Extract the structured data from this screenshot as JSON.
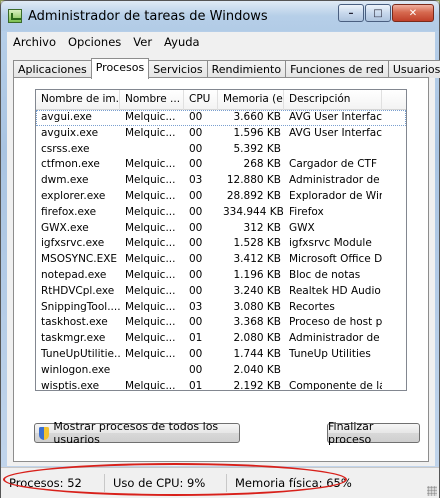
{
  "window": {
    "title": "Administrador de tareas de Windows"
  },
  "menu": [
    "Archivo",
    "Opciones",
    "Ver",
    "Ayuda"
  ],
  "tabs": [
    {
      "label": "Aplicaciones",
      "active": false
    },
    {
      "label": "Procesos",
      "active": true
    },
    {
      "label": "Servicios",
      "active": false
    },
    {
      "label": "Rendimiento",
      "active": false
    },
    {
      "label": "Funciones de red",
      "active": false
    },
    {
      "label": "Usuarios",
      "active": false
    }
  ],
  "columns": [
    "Nombre de im...",
    "Nombre ...",
    "CPU",
    "Memoria (e...",
    "Descripción"
  ],
  "processes": [
    {
      "name": "avgui.exe",
      "user": "Melquic...",
      "cpu": "00",
      "mem": "3.660 KB",
      "desc": "AVG User Interface"
    },
    {
      "name": "avguix.exe",
      "user": "Melquic...",
      "cpu": "00",
      "mem": "1.596 KB",
      "desc": "AVG User Interface"
    },
    {
      "name": "csrss.exe",
      "user": "",
      "cpu": "00",
      "mem": "5.392 KB",
      "desc": ""
    },
    {
      "name": "ctfmon.exe",
      "user": "Melquic...",
      "cpu": "00",
      "mem": "268 KB",
      "desc": "Cargador de CTF"
    },
    {
      "name": "dwm.exe",
      "user": "Melquic...",
      "cpu": "03",
      "mem": "12.880 KB",
      "desc": "Administrador de ..."
    },
    {
      "name": "explorer.exe",
      "user": "Melquic...",
      "cpu": "00",
      "mem": "28.892 KB",
      "desc": "Explorador de Win..."
    },
    {
      "name": "firefox.exe",
      "user": "Melquic...",
      "cpu": "00",
      "mem": "334.944 KB",
      "desc": "Firefox"
    },
    {
      "name": "GWX.exe",
      "user": "Melquic...",
      "cpu": "00",
      "mem": "312 KB",
      "desc": "GWX"
    },
    {
      "name": "igfxsrvc.exe",
      "user": "Melquic...",
      "cpu": "00",
      "mem": "1.528 KB",
      "desc": "igfxsrvc Module"
    },
    {
      "name": "MSOSYNC.EXE",
      "user": "Melquic...",
      "cpu": "00",
      "mem": "3.412 KB",
      "desc": "Microsoft Office D..."
    },
    {
      "name": "notepad.exe",
      "user": "Melquic...",
      "cpu": "00",
      "mem": "1.196 KB",
      "desc": "Bloc de notas"
    },
    {
      "name": "RtHDVCpl.exe",
      "user": "Melquic...",
      "cpu": "00",
      "mem": "3.240 KB",
      "desc": "Realtek HD Audio ..."
    },
    {
      "name": "SnippingTool....",
      "user": "Melquic...",
      "cpu": "03",
      "mem": "3.080 KB",
      "desc": "Recortes"
    },
    {
      "name": "taskhost.exe",
      "user": "Melquic...",
      "cpu": "00",
      "mem": "3.368 KB",
      "desc": "Proceso de host p..."
    },
    {
      "name": "taskmgr.exe",
      "user": "Melquic...",
      "cpu": "01",
      "mem": "2.080 KB",
      "desc": "Administrador de t..."
    },
    {
      "name": "TuneUpUtilitie...",
      "user": "Melquic...",
      "cpu": "00",
      "mem": "1.744 KB",
      "desc": "TuneUp Utilities"
    },
    {
      "name": "winlogon.exe",
      "user": "",
      "cpu": "00",
      "mem": "2.040 KB",
      "desc": ""
    },
    {
      "name": "wisptis.exe",
      "user": "Melquic...",
      "cpu": "01",
      "mem": "2.192 KB",
      "desc": "Componente de lá..."
    }
  ],
  "buttons": {
    "show_all": "Mostrar procesos de todos los usuarios",
    "end_process": "Finalizar proceso"
  },
  "status": {
    "processes": "Procesos: 52",
    "cpu": "Uso de CPU: 9%",
    "memory": "Memoria física: 65%"
  },
  "icons": {
    "app": "task-manager-icon",
    "shield": "uac-shield-icon"
  },
  "colors": {
    "annotation_circle": "#d8201a"
  }
}
